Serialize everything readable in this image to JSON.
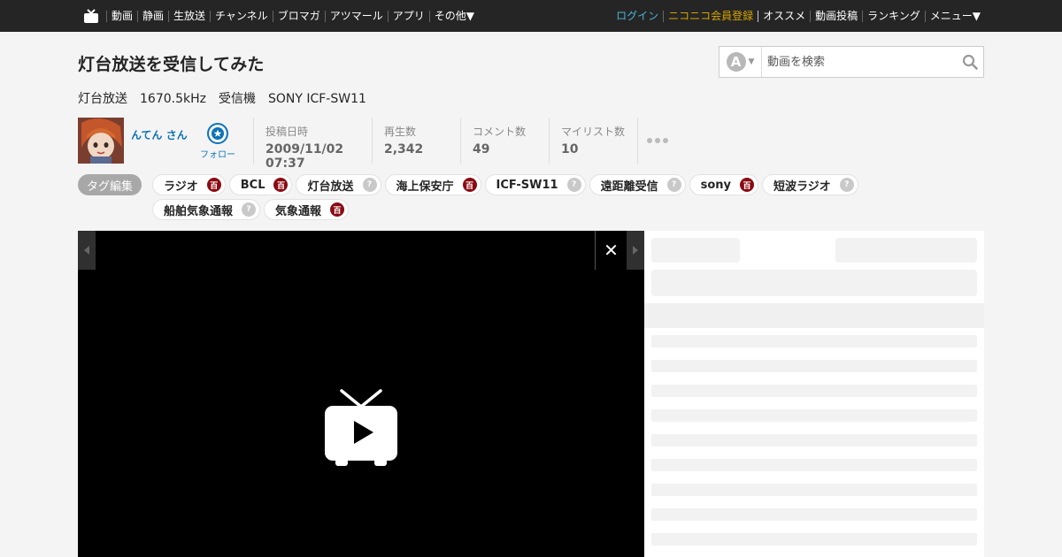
{
  "nav": {
    "left_items": [
      "動画",
      "静画",
      "生放送",
      "チャンネル",
      "ブロマガ",
      "アツマール",
      "アプリ",
      "その他▼"
    ],
    "login": "ログイン",
    "premium": "ニコニコ会員登録",
    "right_items": [
      "オススメ",
      "動画投稿",
      "ランキング",
      "メニュー▼"
    ]
  },
  "video": {
    "title": "灯台放送を受信してみた",
    "description": "灯台放送　1670.5kHz　受信機　SONY ICF-SW11"
  },
  "search": {
    "type_badge": "A",
    "placeholder": "動画を検索"
  },
  "owner": {
    "name": "んてん さん",
    "follow_label": "フォロー"
  },
  "meta": {
    "posted_label": "投稿日時",
    "posted_value": "2009/11/02 07:37",
    "views_label": "再生数",
    "views_value": "2,342",
    "comments_label": "コメント数",
    "comments_value": "49",
    "mylist_label": "マイリスト数",
    "mylist_value": "10"
  },
  "tags": {
    "edit_label": "タグ編集",
    "items": [
      {
        "label": "ラジオ",
        "dict": true
      },
      {
        "label": "BCL",
        "dict": true
      },
      {
        "label": "灯台放送",
        "dict": false
      },
      {
        "label": "海上保安庁",
        "dict": true
      },
      {
        "label": "ICF-SW11",
        "dict": false
      },
      {
        "label": "遠距離受信",
        "dict": false
      },
      {
        "label": "sony",
        "dict": true
      },
      {
        "label": "短波ラジオ",
        "dict": false
      },
      {
        "label": "船舶気象通報",
        "dict": false
      },
      {
        "label": "気象通報",
        "dict": true
      }
    ],
    "dict_icon_glyph": "百",
    "nodict_icon_glyph": "?"
  },
  "player": {
    "close_glyph": "✕"
  },
  "colors": {
    "topbar": "#252525",
    "link_blue": "#0c73b7",
    "premium_gold": "#d6a400",
    "login_blue": "#4cb5d9",
    "dict_red": "#8b0b12"
  }
}
